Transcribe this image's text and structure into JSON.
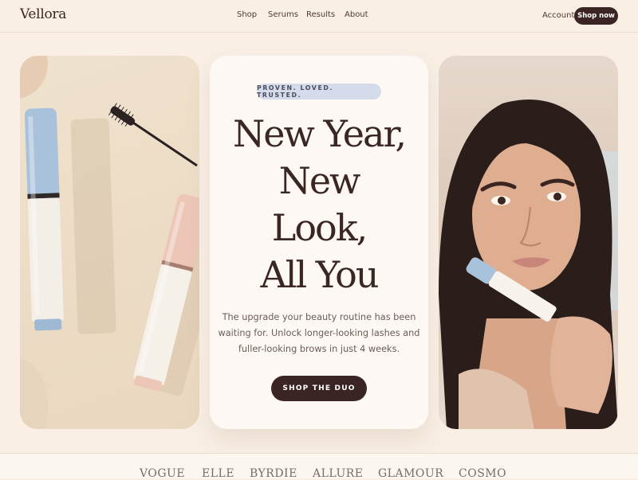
{
  "brand": {
    "name": "Vellora"
  },
  "nav": {
    "items": [
      "Shop",
      "Serums",
      "Results",
      "About"
    ]
  },
  "header": {
    "account_label": "Account",
    "cta_label": "Shop now"
  },
  "hero": {
    "badge": "PROVEN. LOVED. TRUSTED.",
    "headline_lines": [
      "New Year,",
      "New",
      "Look,",
      "All You"
    ],
    "subtext_lines": [
      "The upgrade your beauty routine has been",
      "waiting for. Unlock longer-looking lashes and",
      "fuller-looking brows in just 4 weeks."
    ],
    "cta_label": "SHOP THE DUO"
  },
  "press": {
    "logos": [
      "VOGUE",
      "ELLE",
      "BYRDIE",
      "ALLURE",
      "GLAMOUR",
      "COSMO"
    ]
  },
  "colors": {
    "background": "#f9efe5",
    "dark_brown": "#3b2524",
    "badge_blue": "#d4dcec",
    "card": "#fdf8f3"
  }
}
